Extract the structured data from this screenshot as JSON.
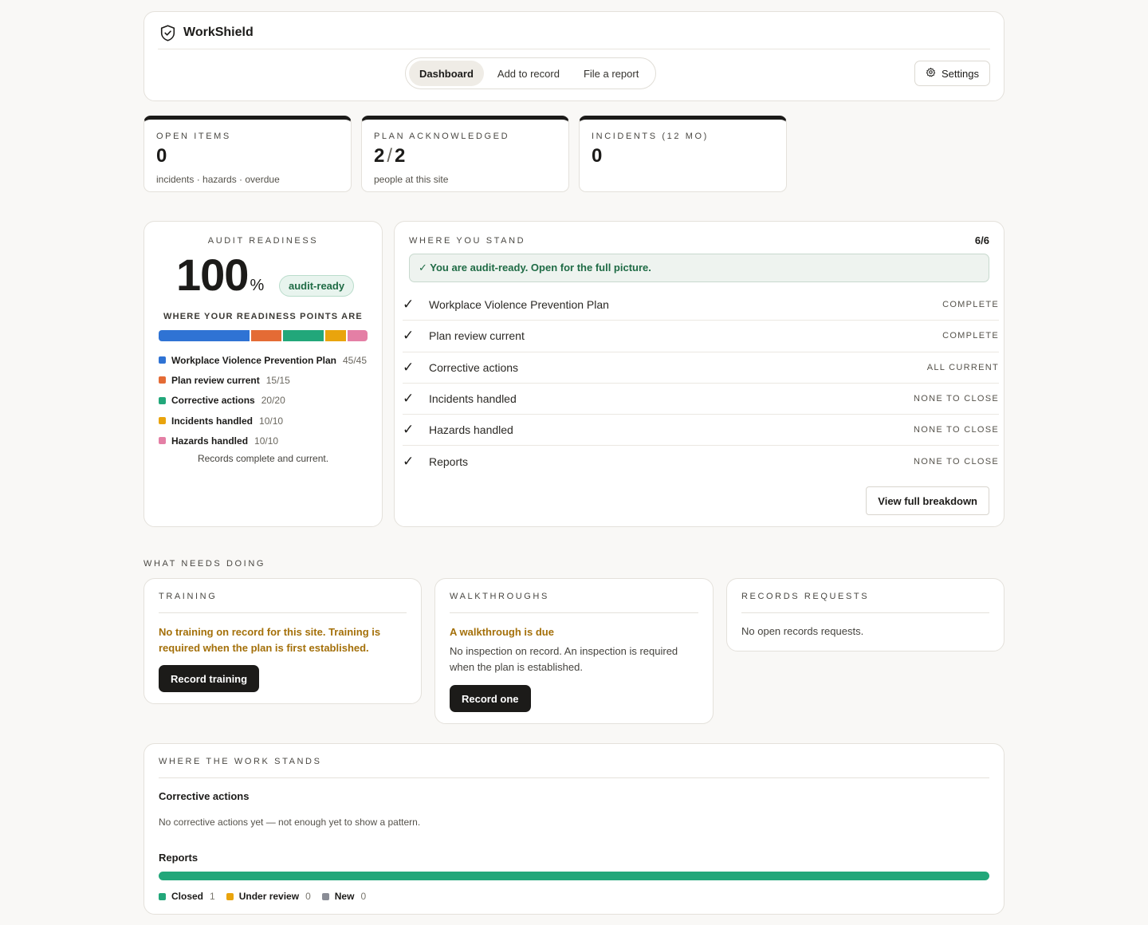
{
  "app": {
    "name": "WorkShield",
    "nav": [
      {
        "label": "Dashboard",
        "active": true
      },
      {
        "label": "Add to record",
        "active": false
      },
      {
        "label": "File a report",
        "active": false
      }
    ],
    "settings_label": "Settings"
  },
  "stats": [
    {
      "label": "Open items",
      "value": "0",
      "sub": "incidents · hazards · overdue"
    },
    {
      "label": "Plan acknowledged",
      "value_a": "2",
      "value_sep": "/",
      "value_b": "2",
      "sub": "people at this site"
    },
    {
      "label": "Incidents (12 mo)",
      "value": "0",
      "sub": ""
    }
  ],
  "audit": {
    "title": "Audit readiness",
    "score": "100",
    "score_unit": "%",
    "badge": "audit-ready",
    "points_title": "Where your readiness points are",
    "segments": [
      {
        "label": "Workplace Violence Prevention Plan",
        "value": "45/45",
        "points": 45,
        "color": "#2f73d4"
      },
      {
        "label": "Plan review current",
        "value": "15/15",
        "points": 15,
        "color": "#e46b35"
      },
      {
        "label": "Corrective actions",
        "value": "20/20",
        "points": 20,
        "color": "#22a77a"
      },
      {
        "label": "Incidents handled",
        "value": "10/10",
        "points": 10,
        "color": "#e9a40d"
      },
      {
        "label": "Hazards handled",
        "value": "10/10",
        "points": 10,
        "color": "#e47fa5"
      }
    ],
    "footer": "Records complete and current."
  },
  "stand": {
    "title": "Where you stand",
    "count": "6/6",
    "banner": "✓ You are audit-ready. Open for the full picture.",
    "rows": [
      {
        "check": "✓",
        "name": "Workplace Violence Prevention Plan",
        "status": "Complete"
      },
      {
        "check": "✓",
        "name": "Plan review current",
        "status": "Complete"
      },
      {
        "check": "✓",
        "name": "Corrective actions",
        "status": "All current"
      },
      {
        "check": "✓",
        "name": "Incidents handled",
        "status": "None to close"
      },
      {
        "check": "✓",
        "name": "Hazards handled",
        "status": "None to close"
      },
      {
        "check": "✓",
        "name": "Reports",
        "status": "None to close"
      }
    ],
    "button": "View full breakdown"
  },
  "needs": {
    "section_label": "What needs doing",
    "training": {
      "title": "Training",
      "warning": "No training on record for this site. Training is required when the plan is first established.",
      "button": "Record training"
    },
    "walkthroughs": {
      "title": "Walkthroughs",
      "warning": "A walkthrough is due",
      "body": "No inspection on record. An inspection is required when the plan is established.",
      "button": "Record one"
    },
    "records": {
      "title": "Records requests",
      "body": "No open records requests."
    }
  },
  "work": {
    "title": "Where the work stands",
    "corrective_heading": "Corrective actions",
    "corrective_text": "No corrective actions yet — not enough yet to show a pattern.",
    "reports_heading": "Reports",
    "reports": [
      {
        "label": "Closed",
        "count": 1,
        "color": "#22a77a"
      },
      {
        "label": "Under review",
        "count": 0,
        "color": "#e9a40d"
      },
      {
        "label": "New",
        "count": 0,
        "color": "#8a8d96"
      }
    ]
  },
  "colors": {
    "accent_dark": "#1c1b19",
    "success_green": "#1f6b45",
    "warning_amber": "#a4700a"
  },
  "icons": {
    "brand": "shield-check-icon",
    "settings": "gear-icon",
    "check": "checkmark-icon"
  }
}
